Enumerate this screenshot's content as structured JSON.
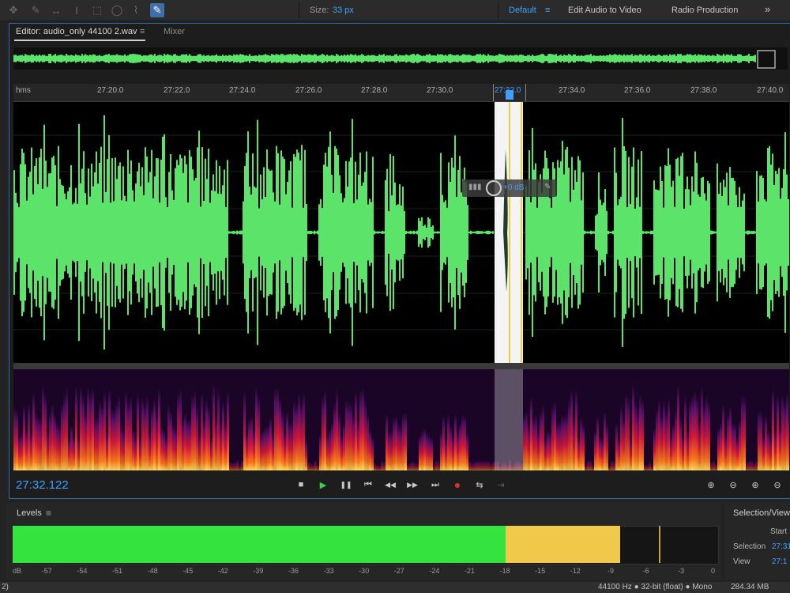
{
  "toolbar": {
    "tools": [
      "move-tool-icon",
      "razor-tool-icon",
      "slip-tool-icon",
      "time-selection-tool-icon",
      "marquee-tool-icon",
      "lasso-tool-icon",
      "brush-tool-icon",
      "spot-healing-brush-icon"
    ],
    "size_label": "Size:",
    "size_value": "33 px",
    "workspaces": {
      "default": "Default",
      "edit_audio_to_video": "Edit Audio to Video",
      "radio_production": "Radio Production"
    },
    "overflow": "»"
  },
  "editor": {
    "tab_label": "Editor: audio_only 44100 2.wav",
    "tab_menu": "≡",
    "mixer_label": "Mixer",
    "ruler": {
      "unit": "hms",
      "ticks": [
        "27:20.0",
        "27:22.0",
        "27:24.0",
        "27:26.0",
        "27:28.0",
        "27:30.0",
        "27:32.0",
        "27:34.0",
        "27:36.0",
        "27:38.0",
        "27:40.0"
      ]
    },
    "hud": {
      "gain": "+0 dB"
    },
    "timecode": "27:32.122",
    "transport": {
      "stop": "■",
      "play": "▶",
      "pause": "❚❚",
      "to_start": "⏮",
      "rewind": "◀◀",
      "fast_forward": "▶▶",
      "to_end": "⏭",
      "record": "●"
    },
    "colors": {
      "waveform": "#5ce36a",
      "playhead": "#f4f4f4",
      "accent": "#3fa0ff"
    }
  },
  "levels": {
    "title": "Levels",
    "menu": "≡",
    "db_ticks": [
      "dB",
      "-57",
      "-54",
      "-51",
      "-48",
      "-45",
      "-42",
      "-39",
      "-36",
      "-33",
      "-30",
      "-27",
      "-24",
      "-21",
      "-18",
      "-15",
      "-12",
      "-9",
      "-6",
      "-3",
      "0"
    ],
    "green_end_db": -18,
    "yellow_end_db": -8.3,
    "peak_hold_db": -5
  },
  "selection_view": {
    "title": "Selection/View",
    "start_header": "Start",
    "selection_label": "Selection",
    "selection_start": "27:31",
    "view_label": "View",
    "view_start": "27:1"
  },
  "status": {
    "format": "44100 Hz ● 32-bit (float) ● Mono",
    "size": "284.34 MB",
    "left_fragment": "2)"
  }
}
